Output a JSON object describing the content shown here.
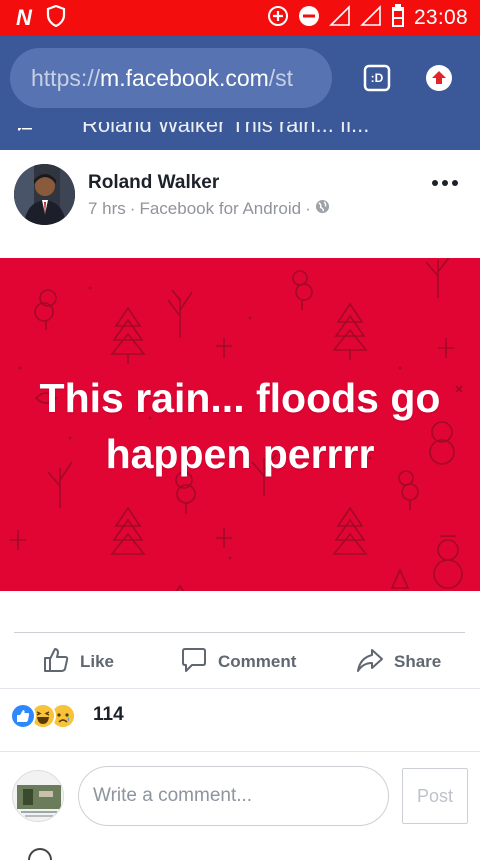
{
  "statusbar": {
    "time": "23:08",
    "left_app_icon": "N",
    "icons": [
      "shield-icon",
      "data-saver-icon",
      "do-not-disturb-icon",
      "signal-icon",
      "signal-icon",
      "battery-low-icon"
    ]
  },
  "browser": {
    "url_scheme": "https://",
    "url_host": "m.facebook.com",
    "url_path": "/st",
    "tab_switch_label": ":D",
    "upload_icon": "upload-arrow-icon"
  },
  "page_header": {
    "partial_title": "Roland Walker   This rain... fl..."
  },
  "post": {
    "author": "Roland Walker",
    "time": "7 hrs",
    "separator": "·",
    "source": "Facebook for Android",
    "privacy_icon": "globe-icon",
    "text": "This rain... floods go happen perrrr",
    "background_color": "#e10534"
  },
  "actions": {
    "like": "Like",
    "comment": "Comment",
    "share": "Share"
  },
  "reactions": {
    "types": [
      "like",
      "haha",
      "sad"
    ],
    "count": "114"
  },
  "comment_box": {
    "placeholder": "Write a comment...",
    "post_label": "Post"
  },
  "colors": {
    "status_bar": "#f40d0d",
    "facebook_blue": "#3b5998",
    "banner_red": "#e10534"
  }
}
